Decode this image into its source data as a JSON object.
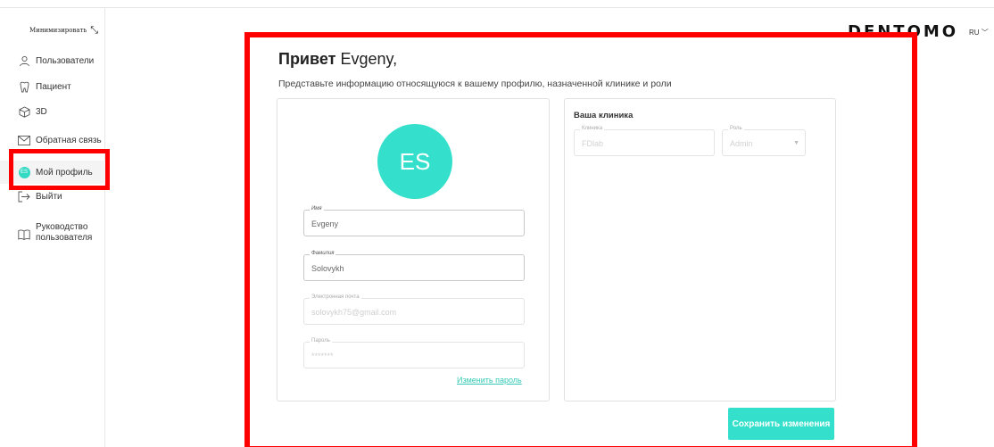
{
  "sidebar": {
    "minimize_label": "Минимизировать",
    "minimize_icon": "collapse-arrows-icon",
    "items": [
      {
        "label": "Пользователи",
        "icon": "users-icon"
      },
      {
        "label": "Пациент",
        "icon": "tooth-icon"
      },
      {
        "label": "3D",
        "icon": "cube-icon"
      },
      {
        "label": "Обратная связь",
        "icon": "envelope-icon"
      },
      {
        "label": "Мой профиль",
        "icon": "avatar-icon",
        "initials": "ES",
        "active": true
      },
      {
        "label": "Выйти",
        "icon": "logout-icon"
      },
      {
        "label": "Руководство пользователя",
        "icon": "book-icon"
      }
    ]
  },
  "header": {
    "brand": "DENTOMO",
    "lang": "RU"
  },
  "main": {
    "greet_prefix": "Привет",
    "greet_name": "Evgeny,",
    "subtitle": "Представьте информацию относящуюся к вашему профилю, назначенной клинике и роли",
    "avatar_initials": "ES",
    "fields": {
      "first_name": {
        "label": "Имя",
        "value": "Evgeny"
      },
      "last_name": {
        "label": "Фамилия",
        "value": "Solovykh"
      },
      "email": {
        "label": "Электронная почта",
        "value": "solovykh75@gmail.com"
      },
      "password": {
        "label": "Пароль",
        "value": "*******"
      }
    },
    "change_password": "Изменить пароль",
    "clinic_title": "Ваша клиника",
    "clinic": {
      "label": "Клиника",
      "value": "FDlab"
    },
    "role": {
      "label": "Роль",
      "value": "Admin"
    },
    "save_button": "Сохранить изменения"
  },
  "colors": {
    "accent": "#34e0cb",
    "highlight": "#ff0000"
  }
}
